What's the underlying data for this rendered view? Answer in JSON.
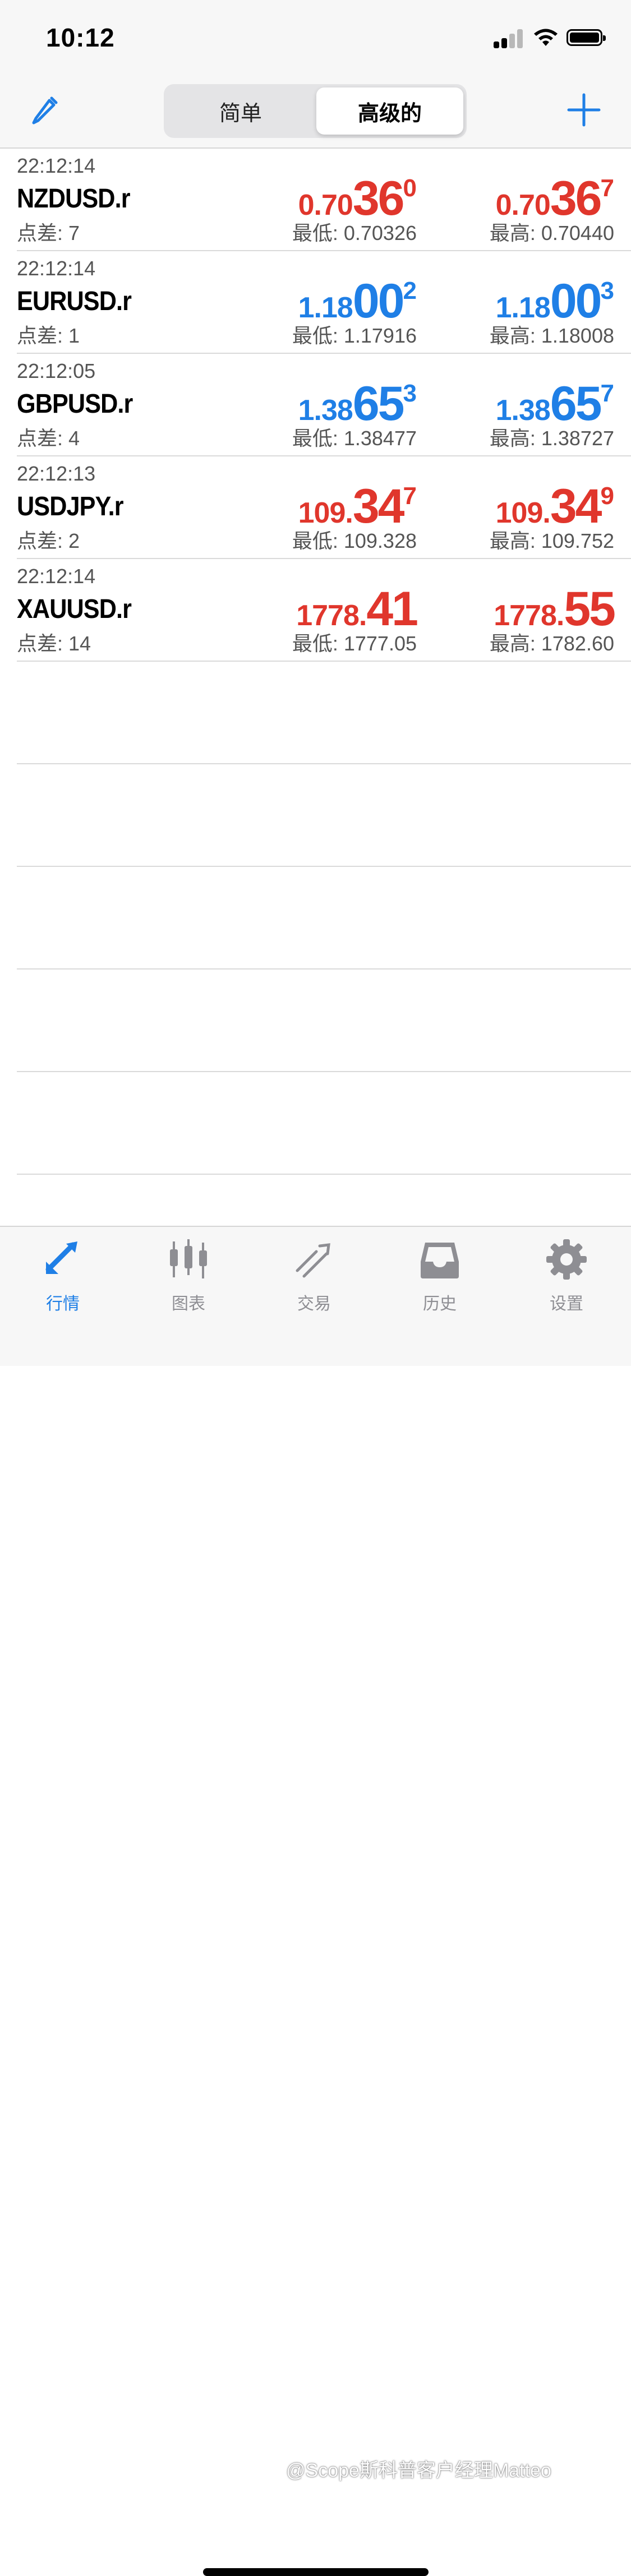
{
  "status": {
    "time": "10:12"
  },
  "nav": {
    "segment_simple": "简单",
    "segment_advanced": "高级的",
    "selected_segment": "高级的"
  },
  "quotes": [
    {
      "time": "22:12:14",
      "symbol": "NZDUSD.r",
      "spread": "点差: 7",
      "bid": {
        "small": "0.70",
        "big": "36",
        "pip": "0",
        "color": "#e0362c"
      },
      "ask": {
        "small": "0.70",
        "big": "36",
        "pip": "7",
        "color": "#e0362c"
      },
      "low": "最低: 0.70326",
      "high": "最高: 0.70440"
    },
    {
      "time": "22:12:14",
      "symbol": "EURUSD.r",
      "spread": "点差: 1",
      "bid": {
        "small": "1.18",
        "big": "00",
        "pip": "2",
        "color": "#1f7fe6"
      },
      "ask": {
        "small": "1.18",
        "big": "00",
        "pip": "3",
        "color": "#1f7fe6"
      },
      "low": "最低: 1.17916",
      "high": "最高: 1.18008"
    },
    {
      "time": "22:12:05",
      "symbol": "GBPUSD.r",
      "spread": "点差: 4",
      "bid": {
        "small": "1.38",
        "big": "65",
        "pip": "3",
        "color": "#1f7fe6"
      },
      "ask": {
        "small": "1.38",
        "big": "65",
        "pip": "7",
        "color": "#1f7fe6"
      },
      "low": "最低: 1.38477",
      "high": "最高: 1.38727"
    },
    {
      "time": "22:12:13",
      "symbol": "USDJPY.r",
      "spread": "点差: 2",
      "bid": {
        "small": "109.",
        "big": "34",
        "pip": "7",
        "color": "#e0362c"
      },
      "ask": {
        "small": "109.",
        "big": "34",
        "pip": "9",
        "color": "#e0362c"
      },
      "low": "最低: 109.328",
      "high": "最高: 109.752"
    },
    {
      "time": "22:12:14",
      "symbol": "XAUUSD.r",
      "spread": "点差: 14",
      "bid": {
        "small": "1778.",
        "big": "41",
        "pip": "",
        "color": "#e0362c"
      },
      "ask": {
        "small": "1778.",
        "big": "55",
        "pip": "",
        "color": "#e0362c"
      },
      "low": "最低: 1777.05",
      "high": "最高: 1782.60"
    }
  ],
  "tabs": [
    {
      "label": "行情",
      "icon": "quotes-icon",
      "active": true
    },
    {
      "label": "图表",
      "icon": "chart-icon",
      "active": false
    },
    {
      "label": "交易",
      "icon": "trade-icon",
      "active": false
    },
    {
      "label": "历史",
      "icon": "history-icon",
      "active": false
    },
    {
      "label": "设置",
      "icon": "settings-icon",
      "active": false
    }
  ],
  "watermark": "@Scope斯科普客户经理Matteo",
  "colors": {
    "accent": "#1f7fe6",
    "down": "#e0362c",
    "up": "#1f7fe6"
  }
}
